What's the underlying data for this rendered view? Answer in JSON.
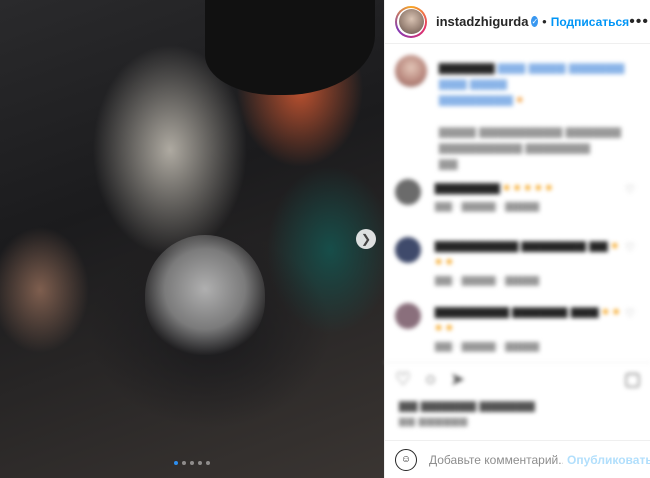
{
  "post": {
    "username": "instadzhigurda",
    "separator": "•",
    "follow_label": "Подписаться",
    "more_icon": "more-horizontal-icon",
    "next_icon": "chevron-right-icon",
    "carousel": {
      "count": 5,
      "active_index": 0
    }
  },
  "comment_box": {
    "placeholder": "Добавьте комментарий...",
    "publish_label": "Опубликовать"
  },
  "colors": {
    "link_blue": "#0095f6",
    "verified_blue": "#3897f0",
    "publish_disabled": "#b2dffc"
  }
}
